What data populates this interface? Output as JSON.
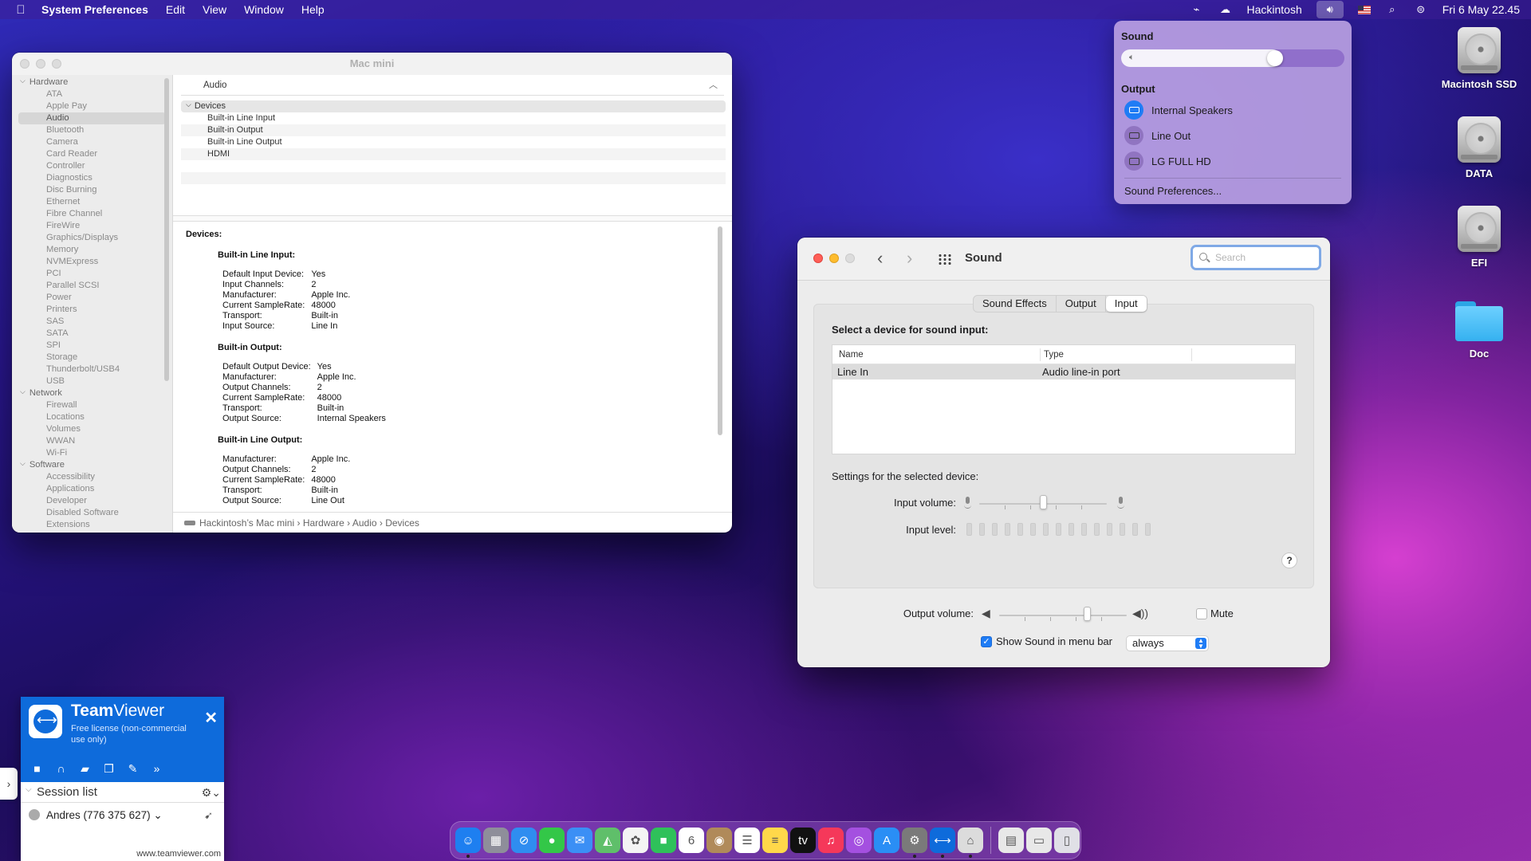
{
  "menubar": {
    "apple": "",
    "app_name": "System Preferences",
    "menus": [
      "Edit",
      "View",
      "Window",
      "Help"
    ],
    "user": "Hackintosh",
    "datetime": "Fri 6 May  22.45"
  },
  "sysinfo": {
    "title": "Mac mini",
    "sidebar": [
      {
        "type": "group",
        "label": "Hardware"
      },
      {
        "type": "item",
        "label": "ATA"
      },
      {
        "type": "item",
        "label": "Apple Pay"
      },
      {
        "type": "item",
        "label": "Audio",
        "selected": true
      },
      {
        "type": "item",
        "label": "Bluetooth"
      },
      {
        "type": "item",
        "label": "Camera"
      },
      {
        "type": "item",
        "label": "Card Reader"
      },
      {
        "type": "item",
        "label": "Controller"
      },
      {
        "type": "item",
        "label": "Diagnostics"
      },
      {
        "type": "item",
        "label": "Disc Burning"
      },
      {
        "type": "item",
        "label": "Ethernet"
      },
      {
        "type": "item",
        "label": "Fibre Channel"
      },
      {
        "type": "item",
        "label": "FireWire"
      },
      {
        "type": "item",
        "label": "Graphics/Displays"
      },
      {
        "type": "item",
        "label": "Memory"
      },
      {
        "type": "item",
        "label": "NVMExpress"
      },
      {
        "type": "item",
        "label": "PCI"
      },
      {
        "type": "item",
        "label": "Parallel SCSI"
      },
      {
        "type": "item",
        "label": "Power"
      },
      {
        "type": "item",
        "label": "Printers"
      },
      {
        "type": "item",
        "label": "SAS"
      },
      {
        "type": "item",
        "label": "SATA"
      },
      {
        "type": "item",
        "label": "SPI"
      },
      {
        "type": "item",
        "label": "Storage"
      },
      {
        "type": "item",
        "label": "Thunderbolt/USB4"
      },
      {
        "type": "item",
        "label": "USB"
      },
      {
        "type": "group",
        "label": "Network"
      },
      {
        "type": "item",
        "label": "Firewall"
      },
      {
        "type": "item",
        "label": "Locations"
      },
      {
        "type": "item",
        "label": "Volumes"
      },
      {
        "type": "item",
        "label": "WWAN"
      },
      {
        "type": "item",
        "label": "Wi-Fi"
      },
      {
        "type": "group",
        "label": "Software"
      },
      {
        "type": "item",
        "label": "Accessibility"
      },
      {
        "type": "item",
        "label": "Applications"
      },
      {
        "type": "item",
        "label": "Developer"
      },
      {
        "type": "item",
        "label": "Disabled Software"
      },
      {
        "type": "item",
        "label": "Extensions"
      }
    ],
    "header": "Audio",
    "tree": {
      "group": "Devices",
      "children": [
        "Built-in Line Input",
        "Built-in Output",
        "Built-in Line Output",
        "HDMI"
      ]
    },
    "detail": {
      "heading": "Devices:",
      "sections": [
        {
          "title": "Built-in Line Input:",
          "rows": [
            [
              "Default Input Device:",
              "Yes"
            ],
            [
              "Input Channels:",
              "2"
            ],
            [
              "Manufacturer:",
              "Apple Inc."
            ],
            [
              "Current SampleRate:",
              "48000"
            ],
            [
              "Transport:",
              "Built-in"
            ],
            [
              "Input Source:",
              "Line In"
            ]
          ]
        },
        {
          "title": "Built-in Output:",
          "rows": [
            [
              "Default Output Device:",
              "Yes"
            ],
            [
              "Manufacturer:",
              "Apple Inc."
            ],
            [
              "Output Channels:",
              "2"
            ],
            [
              "Current SampleRate:",
              "48000"
            ],
            [
              "Transport:",
              "Built-in"
            ],
            [
              "Output Source:",
              "Internal Speakers"
            ]
          ]
        },
        {
          "title": "Built-in Line Output:",
          "rows": [
            [
              "Manufacturer:",
              "Apple Inc."
            ],
            [
              "Output Channels:",
              "2"
            ],
            [
              "Current SampleRate:",
              "48000"
            ],
            [
              "Transport:",
              "Built-in"
            ],
            [
              "Output Source:",
              "Line Out"
            ]
          ]
        }
      ]
    },
    "path": "Hackintosh’s Mac mini  ›  Hardware  ›  Audio  ›  Devices"
  },
  "sound_menu": {
    "title": "Sound",
    "volume": 0.69,
    "output_label": "Output",
    "outputs": [
      {
        "label": "Internal Speakers",
        "selected": true
      },
      {
        "label": "Line Out",
        "selected": false
      },
      {
        "label": "LG FULL HD",
        "selected": false
      }
    ],
    "prefs_link": "Sound Preferences..."
  },
  "sound_prefs": {
    "title": "Sound",
    "search_placeholder": "Search",
    "tabs": [
      "Sound Effects",
      "Output",
      "Input"
    ],
    "active_tab": "Input",
    "heading": "Select a device for sound input:",
    "columns": [
      "Name",
      "Type"
    ],
    "devices": [
      {
        "name": "Line In",
        "type": "Audio line-in port"
      }
    ],
    "settings_label": "Settings for the selected device:",
    "input_volume_label": "Input volume:",
    "input_volume": 0.5,
    "input_level_label": "Input level:",
    "help": "?",
    "output_volume_label": "Output volume:",
    "output_volume": 0.69,
    "mute_label": "Mute",
    "mute": false,
    "show_in_menubar_label": "Show Sound in menu bar",
    "show_in_menubar": true,
    "show_when": "always"
  },
  "desktop": {
    "icons": [
      "Macintosh SSD",
      "DATA",
      "EFI",
      "Doc"
    ]
  },
  "teamviewer": {
    "brand_bold": "Team",
    "brand_light": "Viewer",
    "subtitle": "Free license (non-commercial use only)",
    "session_list": "Session list",
    "user": "Andres (776 375 627)",
    "footer": "www.teamviewer.com"
  },
  "dock": {
    "apps": [
      {
        "name": "finder",
        "color": "#1e7ff0",
        "glyph": "☺",
        "run": true
      },
      {
        "name": "launchpad",
        "color": "#8e8e9a",
        "glyph": "▦",
        "run": false
      },
      {
        "name": "safari",
        "color": "#2f8df0",
        "glyph": "⊘",
        "run": false
      },
      {
        "name": "messages",
        "color": "#33c748",
        "glyph": "●",
        "run": false
      },
      {
        "name": "mail",
        "color": "#3b8ff5",
        "glyph": "✉",
        "run": false
      },
      {
        "name": "maps",
        "color": "#5fbf6a",
        "glyph": "◭",
        "run": false
      },
      {
        "name": "photos",
        "color": "#f4f4f4",
        "glyph": "✿",
        "run": false
      },
      {
        "name": "facetime",
        "color": "#2fc15a",
        "glyph": "■",
        "run": false
      },
      {
        "name": "calendar",
        "color": "#ffffff",
        "glyph": "6",
        "run": false
      },
      {
        "name": "contacts",
        "color": "#b08a5a",
        "glyph": "◉",
        "run": false
      },
      {
        "name": "reminders",
        "color": "#ffffff",
        "glyph": "☰",
        "run": false
      },
      {
        "name": "notes",
        "color": "#ffd84a",
        "glyph": "≡",
        "run": false
      },
      {
        "name": "tv",
        "color": "#111111",
        "glyph": "tv",
        "run": false
      },
      {
        "name": "music",
        "color": "#f5385a",
        "glyph": "♫",
        "run": false
      },
      {
        "name": "podcasts",
        "color": "#a450e0",
        "glyph": "◎",
        "run": false
      },
      {
        "name": "app-store",
        "color": "#2a8ef5",
        "glyph": "A",
        "run": false
      },
      {
        "name": "system-preferences",
        "color": "#7a7a7a",
        "glyph": "⚙",
        "run": true
      },
      {
        "name": "teamviewer",
        "color": "#0e6bdb",
        "glyph": "⟷",
        "run": true
      },
      {
        "name": "system-information",
        "color": "#dcdcdc",
        "glyph": "⌂",
        "run": true
      },
      {
        "name": "sep",
        "color": "",
        "glyph": "",
        "run": false
      },
      {
        "name": "documents",
        "color": "#e8e8e8",
        "glyph": "▤",
        "run": false
      },
      {
        "name": "downloads",
        "color": "#e8e8e8",
        "glyph": "▭",
        "run": false
      },
      {
        "name": "trash",
        "color": "#e0e0e6",
        "glyph": "▯",
        "run": false
      }
    ]
  }
}
